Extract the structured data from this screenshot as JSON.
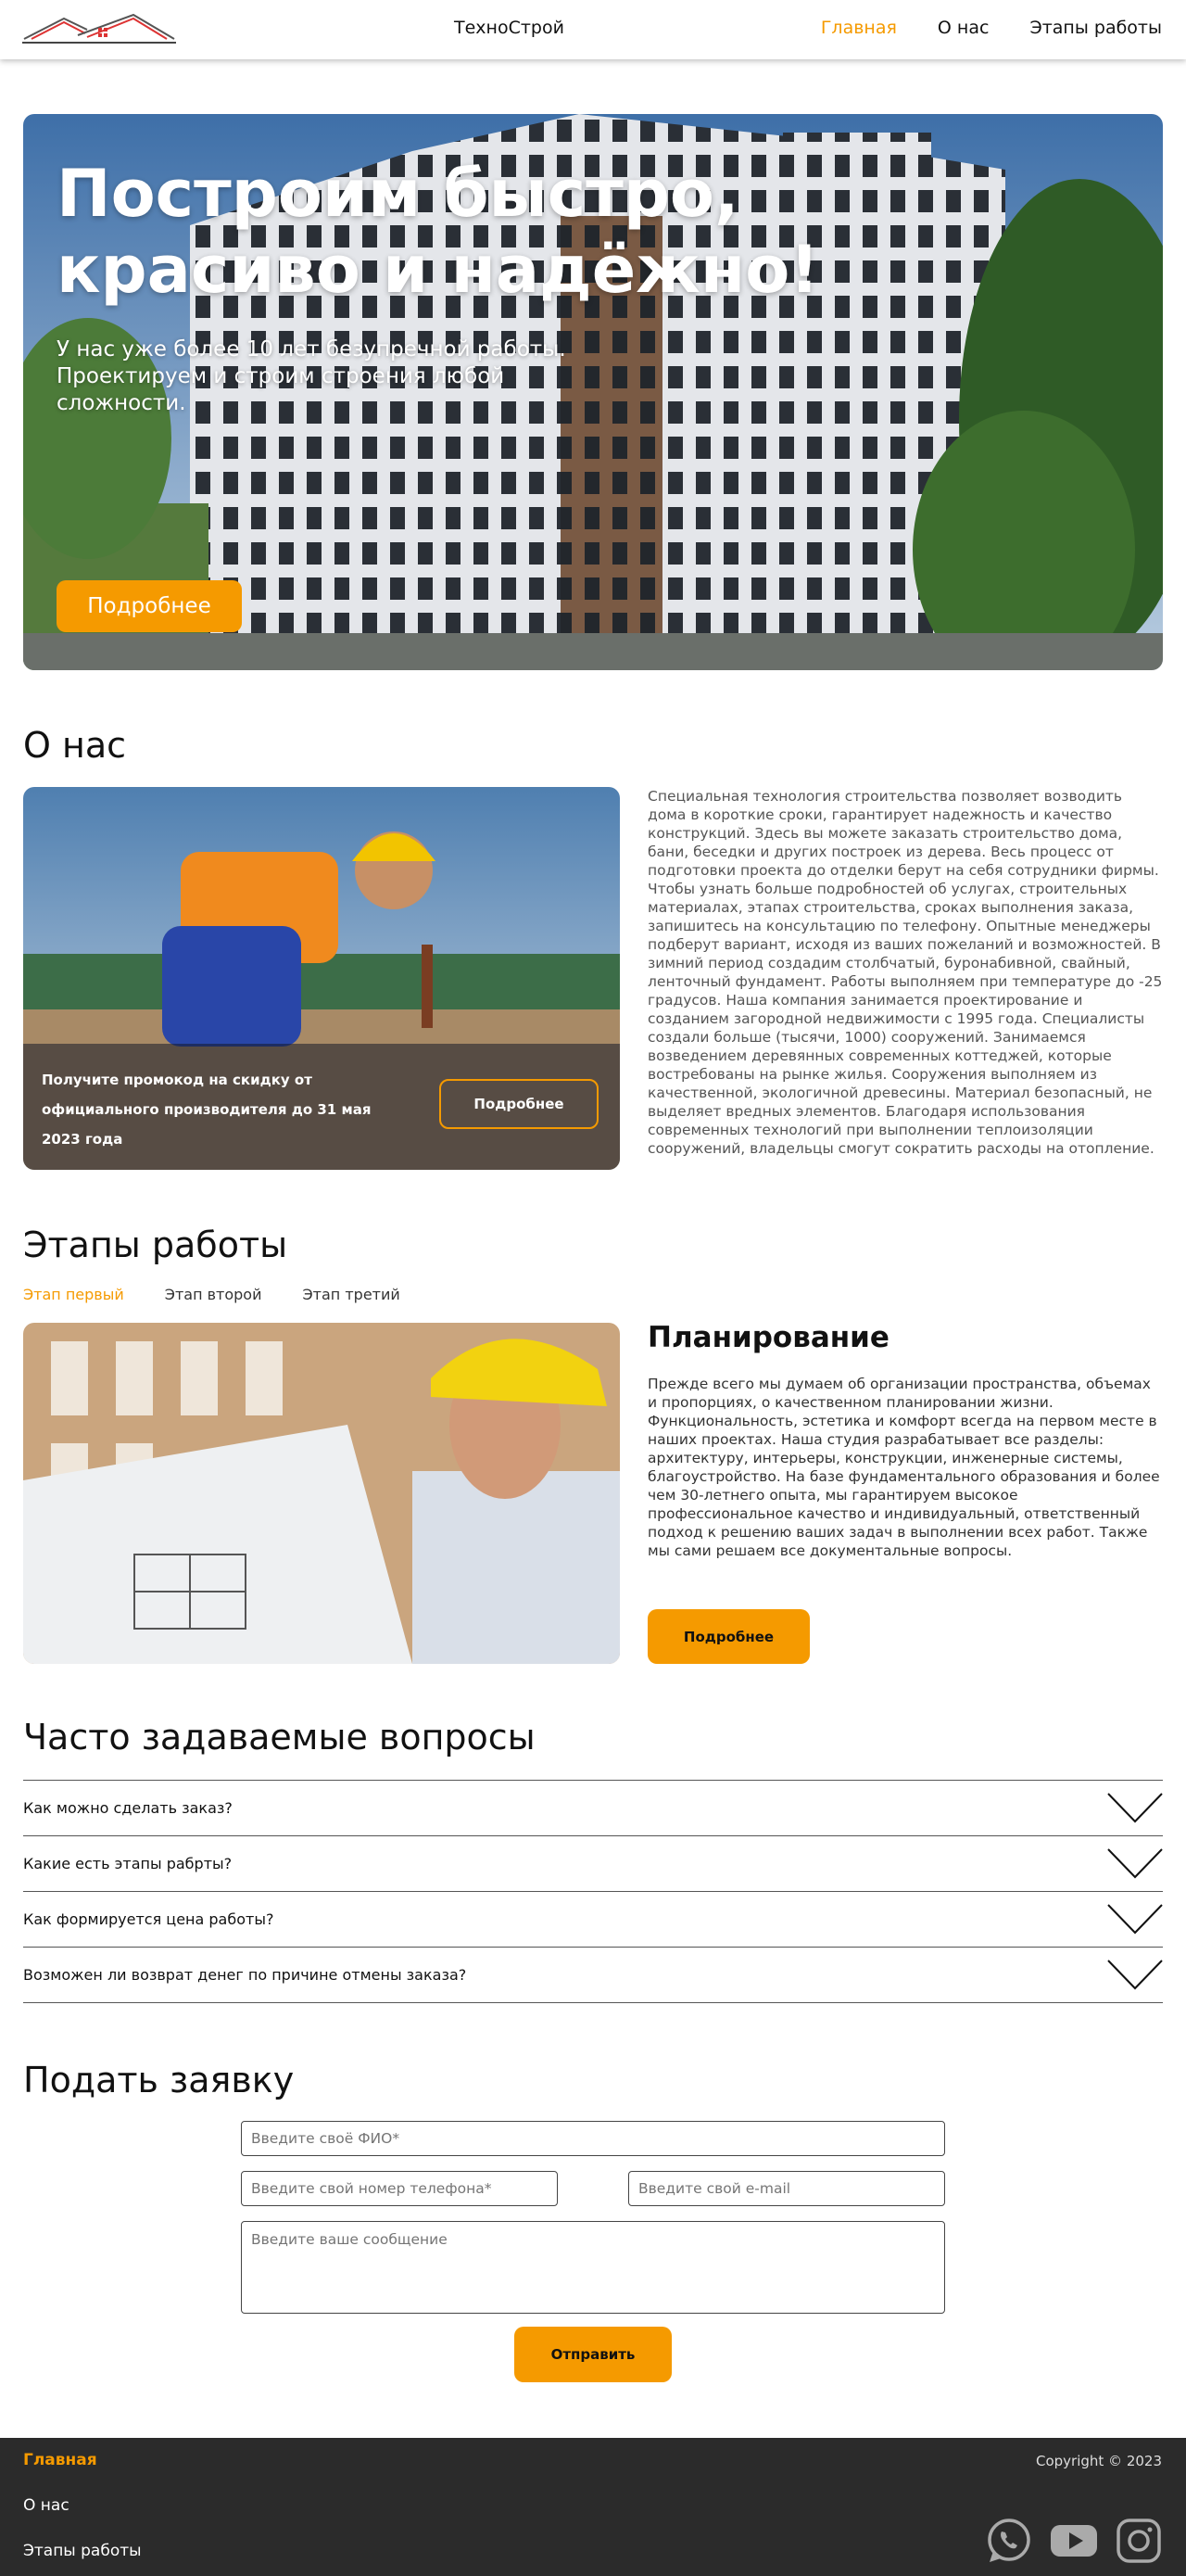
{
  "header": {
    "brand": "ТехноСтрой",
    "nav": [
      {
        "label": "Главная",
        "active": true
      },
      {
        "label": "О нас",
        "active": false
      },
      {
        "label": "Этапы работы",
        "active": false
      }
    ]
  },
  "colors": {
    "accent": "#F59A00",
    "footer_bg": "#2b2b2b"
  },
  "hero": {
    "title": "Построим быстро, красиво и надёжно!",
    "subtitle": "У нас уже более 10 лет безупречной работы. Проектируем и строим строения любой сложности.",
    "button": "Подробнее"
  },
  "about": {
    "title": "О нас",
    "promo": "Получите промокод на скидку от официального производителя до 31 мая 2023 года",
    "promo_button": "Подробнее",
    "text": "Специальная технология строительства позволяет возводить дома в короткие сроки, гарантирует надежность и качество конструкций. Здесь вы можете заказать строительство дома, бани, беседки и других построек из дерева. Весь процесс от подготовки проекта до отделки берут на себя сотрудники фирмы. Чтобы узнать больше подробностей об услугах, строительных материалах, этапах строительства, сроках выполнения заказа, запишитесь на консультацию по телефону. Опытные менеджеры подберут вариант, исходя из ваших пожеланий и возможностей. В зимний период создадим столбчатый, буронабивной, свайный, ленточный фундамент. Работы выполняем при температуре до -25 градусов. Наша компания занимается проектирование и созданием загородной недвижимости с 1995 года. Специалисты создали больше (тысячи, 1000) сооружений. Занимаемся возведением деревянных современных коттеджей, которые востребованы на рынке жилья. Сооружения выполняем из качественной, экологичной древесины. Материал безопасный, не выделяет вредных элементов. Благодаря использования современных технологий при выполнении теплоизоляции сооружений, владельцы смогут сократить расходы на отопление."
  },
  "stages": {
    "title": "Этапы работы",
    "tabs": [
      {
        "label": "Этап первый",
        "active": true
      },
      {
        "label": "Этап второй",
        "active": false
      },
      {
        "label": "Этап третий",
        "active": false
      }
    ],
    "heading": "Планирование",
    "text": "Прежде всего мы думаем об организации пространства, объемах и пропорциях, о качественном планировании жизни. Функциональность, эстетика и комфорт всегда на первом месте в наших проектах. Наша студия разрабатывает все разделы: архитектуру, интерьеры, конструкции, инженерные системы, благоустройство. На базе фундаментального образования и более чем 30-летнего опыта, мы гарантируем высокое профессиональное качество и индивидуальный, ответственный подход к решению ваших задач в выполнении всех работ. Также мы сами решаем все документальные вопросы.",
    "button": "Подробнее"
  },
  "faq": {
    "title": "Часто задаваемые вопросы",
    "items": [
      "Как можно сделать заказ?",
      "Какие есть этапы рабрты?",
      "Как формируется цена работы?",
      "Возможен ли возврат денег по причине отмены заказа?"
    ]
  },
  "form": {
    "title": "Подать заявку",
    "name_placeholder": "Введите своё ФИО*",
    "phone_placeholder": "Введите свой номер телефона*",
    "email_placeholder": "Введите свой e-mail",
    "message_placeholder": "Введите ваше сообщение",
    "submit": "Отправить"
  },
  "footer": {
    "nav": [
      "Главная",
      "О нас",
      "Этапы работы"
    ],
    "copyright": "Copyright © 2023",
    "social_icons": [
      "whatsapp-icon",
      "youtube-icon",
      "instagram-icon"
    ]
  }
}
